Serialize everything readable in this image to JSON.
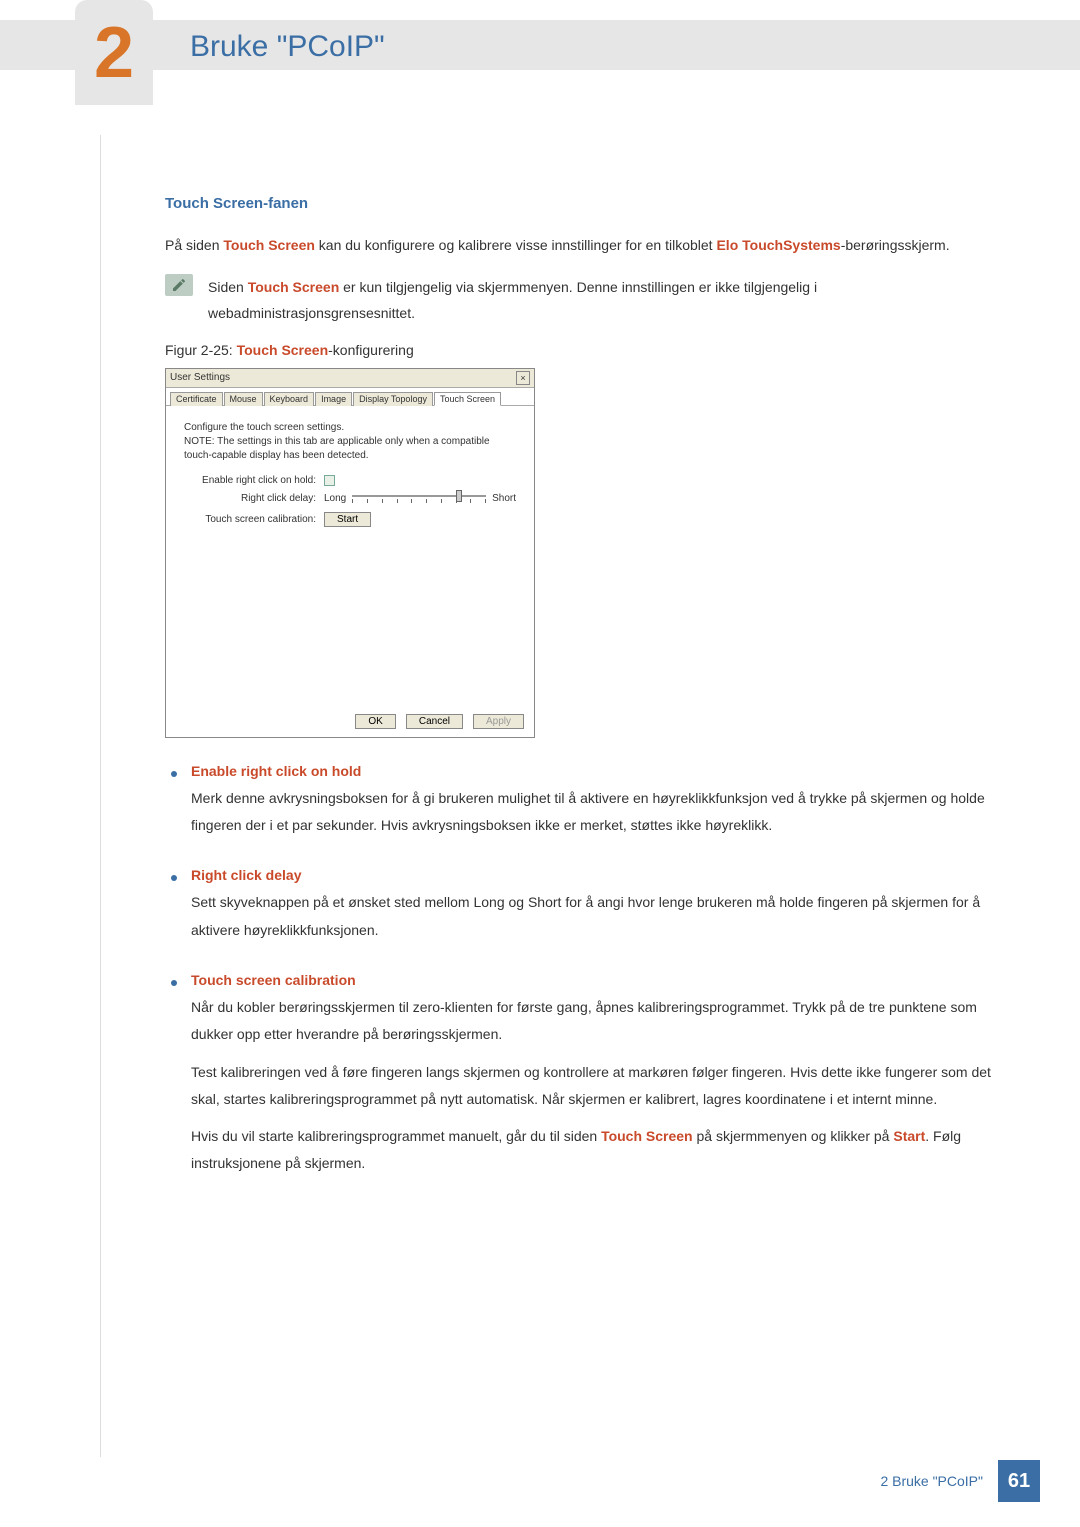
{
  "chapter": {
    "number": "2",
    "title": "Bruke \"PCoIP\""
  },
  "section": {
    "title": "Touch Screen-fanen"
  },
  "intro": {
    "prefix": "På siden ",
    "highlight1": "Touch Screen",
    "mid": " kan du konfigurere og kalibrere visse innstillinger for en tilkoblet ",
    "highlight2": "Elo TouchSystems",
    "suffix": "-berøringsskjerm."
  },
  "note": {
    "prefix": "Siden ",
    "highlight": "Touch Screen",
    "rest": " er kun tilgjengelig via skjermmenyen. Denne innstillingen er ikke tilgjengelig i webadministrasjonsgrensesnittet."
  },
  "figure": {
    "prefix": "Figur 2-25: ",
    "highlight": "Touch Screen",
    "suffix": "-konfigurering"
  },
  "dialog": {
    "title": "User Settings",
    "close": "×",
    "tabs": [
      "Certificate",
      "Mouse",
      "Keyboard",
      "Image",
      "Display Topology",
      "Touch Screen"
    ],
    "active_tab_index": 5,
    "intro_line1": "Configure the touch screen settings.",
    "intro_line2": "NOTE: The settings in this tab are applicable only when a compatible touch-capable display has been detected.",
    "rows": {
      "enable_label": "Enable right click on hold:",
      "delay_label": "Right click delay:",
      "delay_long": "Long",
      "delay_short": "Short",
      "calib_label": "Touch screen calibration:",
      "start_btn": "Start"
    },
    "buttons": {
      "ok": "OK",
      "cancel": "Cancel",
      "apply": "Apply"
    }
  },
  "bullets": [
    {
      "title": "Enable right click on hold",
      "paragraphs": [
        "Merk denne avkrysningsboksen for å gi brukeren mulighet til å aktivere en høyreklikkfunksjon ved å trykke på skjermen og holde fingeren der i et par sekunder. Hvis avkrysningsboksen ikke er merket, støttes ikke høyreklikk."
      ]
    },
    {
      "title": "Right click delay",
      "paragraphs": [
        "Sett skyveknappen på et ønsket sted mellom Long og Short for å angi hvor lenge brukeren må holde fingeren på skjermen for å aktivere høyreklikkfunksjonen."
      ]
    },
    {
      "title": "Touch screen calibration",
      "paragraphs": [
        "Når du kobler berøringsskjermen til zero-klienten for første gang, åpnes kalibreringsprogrammet. Trykk på de tre punktene som dukker opp etter hverandre på berøringsskjermen.",
        "Test kalibreringen ved å føre fingeren langs skjermen og kontrollere at markøren følger fingeren. Hvis dette ikke fungerer som det skal, startes kalibreringsprogrammet på nytt automatisk. Når skjermen er kalibrert, lagres koordinatene i et internt minne."
      ],
      "final": {
        "p1_a": "Hvis du vil starte kalibreringsprogrammet manuelt, går du til siden ",
        "p1_h1": "Touch Screen",
        "p1_b": " på skjermmenyen og klikker på ",
        "p1_h2": "Start",
        "p1_c": ". Følg instruksjonene på skjermen."
      }
    }
  ],
  "footer": {
    "text": "2 Bruke \"PCoIP\"",
    "page": "61"
  }
}
